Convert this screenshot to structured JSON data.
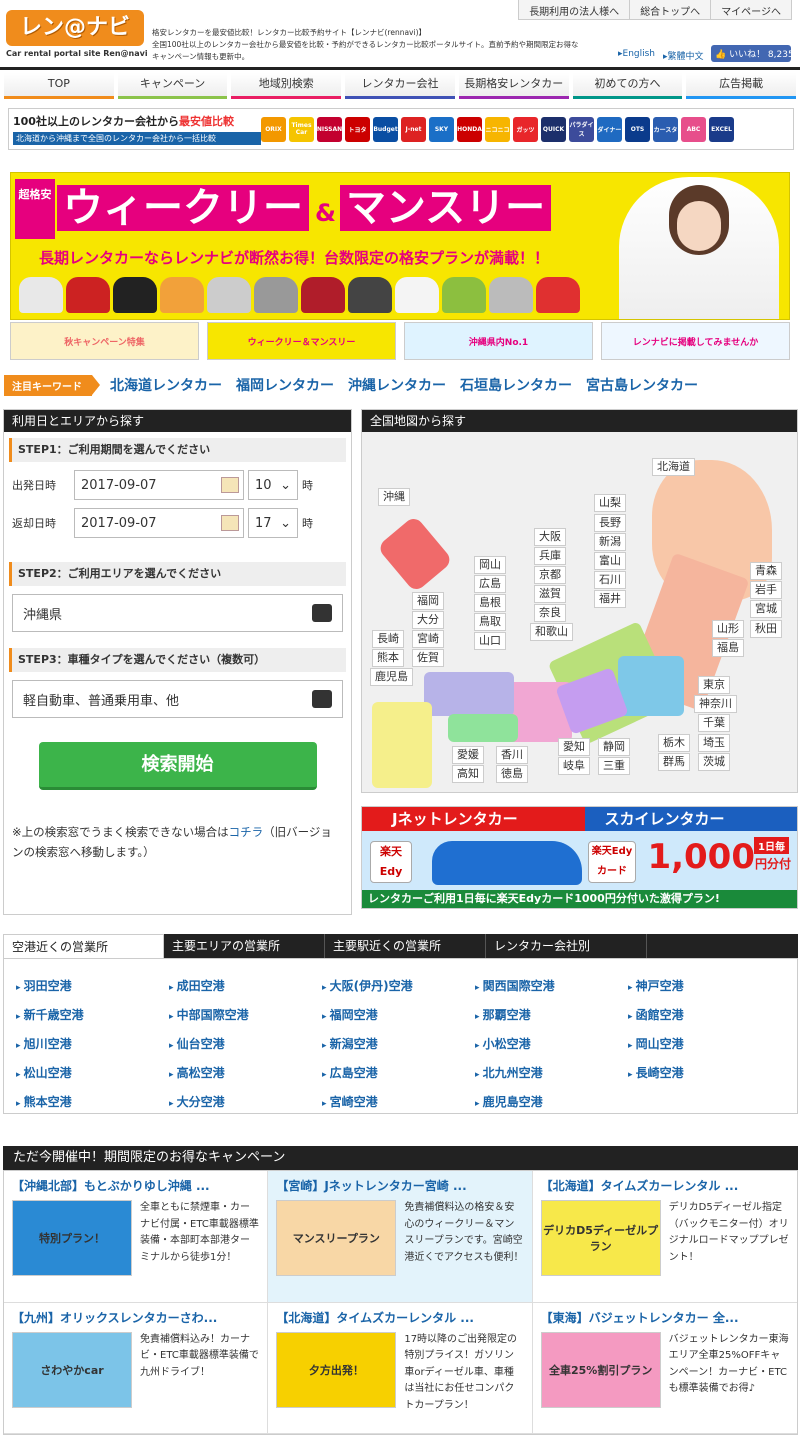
{
  "header": {
    "logo_text": "レン@ナビ",
    "logo_sub": "Car rental portal site Ren@navi",
    "intro_lines": [
      "格安レンタカーを最安値比較！レンタカー比較予約サイト【レンナビ(rennavi)】",
      "全国100社以上のレンタカー会社から最安値を比較・予約ができるレンタカー比較ポータルサイト。直前予約や期間限定お得な",
      "キャンペーン情報も更新中。"
    ],
    "top_links": [
      "長期利用の法人様へ",
      "総合トップへ",
      "マイページへ"
    ],
    "lang": [
      "▸English",
      "▸繁體中文"
    ],
    "like": "👍 いいね！ 8,235"
  },
  "nav": [
    "TOP",
    "キャンペーン",
    "地域別検索",
    "レンタカー会社",
    "長期格安レンタカー",
    "初めての方へ",
    "広告掲載"
  ],
  "company_banner": {
    "line1_a": "100社以上のレンタカー会社から",
    "line1_b": "最安値比較",
    "line2": "北海道から沖縄まで全国のレンタカー会社から一括比較",
    "logos": [
      {
        "name": "ORIX",
        "color": "#f39800"
      },
      {
        "name": "Times Car",
        "color": "#f5c400"
      },
      {
        "name": "NISSAN",
        "color": "#c3002f"
      },
      {
        "name": "トヨタ",
        "color": "#c00"
      },
      {
        "name": "Budget",
        "color": "#0a4ea3"
      },
      {
        "name": "J-net",
        "color": "#d22"
      },
      {
        "name": "SKY",
        "color": "#1a6fc7"
      },
      {
        "name": "HONDA",
        "color": "#cc0000"
      },
      {
        "name": "ニコニコ",
        "color": "#f7b500"
      },
      {
        "name": "ガッツ",
        "color": "#e8262a"
      },
      {
        "name": "QUICK",
        "color": "#1c2f6b"
      },
      {
        "name": "パラダイス",
        "color": "#3c4b9b"
      },
      {
        "name": "ダイナー",
        "color": "#1f6ac1"
      },
      {
        "name": "OTS",
        "color": "#0b3b8c"
      },
      {
        "name": "カースタ",
        "color": "#2a5db0"
      },
      {
        "name": "ABC",
        "color": "#e74e8b"
      },
      {
        "name": "EXCEL",
        "color": "#1a3b8a"
      }
    ]
  },
  "hero": {
    "cho": "超格安",
    "weekly": "ウィークリー",
    "amp": "&",
    "monthly": "マンスリー",
    "sub": "長期レンタカーならレンナビが断然お得！台数限定の格安プランが満載！！"
  },
  "sub_banners": [
    "秋キャンペーン特集",
    "ウィークリー＆マンスリー",
    "沖縄県内No.1",
    "レンナビに掲載してみませんか"
  ],
  "keywords": {
    "label": "注目キーワード",
    "items": [
      "北海道レンタカー",
      "福岡レンタカー",
      "沖縄レンタカー",
      "石垣島レンタカー",
      "宮古島レンタカー"
    ]
  },
  "search": {
    "title": "利用日とエリアから探す",
    "step1": "STEP1：ご利用期間を選んでください",
    "depart_label": "出発日時",
    "depart_date": "2017-09-07",
    "depart_hour": "10",
    "return_label": "返却日時",
    "return_date": "2017-09-07",
    "return_hour": "17",
    "hour_unit": "時",
    "step2": "STEP2：ご利用エリアを選んでください",
    "area": "沖縄県",
    "step3": "STEP3：車種タイプを選んでください（複数可）",
    "car_type": "軽自動車、普通乗用車、他",
    "button": "検索開始",
    "note_a": "※上の検索窓でうまく検索できない場合は",
    "note_link": "コチラ",
    "note_b": "（旧バージョンの検索窓へ移動します。）"
  },
  "map": {
    "title": "全国地図から探す",
    "prefs": [
      "北海道",
      "沖縄",
      "山梨",
      "長野",
      "新潟",
      "富山",
      "石川",
      "福井",
      "大阪",
      "兵庫",
      "京都",
      "滋賀",
      "奈良",
      "和歌山",
      "岡山",
      "広島",
      "島根",
      "鳥取",
      "山口",
      "福岡",
      "大分",
      "長崎",
      "宮崎",
      "熊本",
      "佐賀",
      "鹿児島",
      "青森",
      "岩手",
      "宮城",
      "山形",
      "秋田",
      "福島",
      "東京",
      "神奈川",
      "千葉",
      "栃木",
      "埼玉",
      "群馬",
      "茨城",
      "愛知",
      "静岡",
      "岐阜",
      "三重",
      "愛媛",
      "香川",
      "高知",
      "徳島"
    ]
  },
  "rakuten_banner": {
    "left": "Jネットレンタカー",
    "right": "スカイレンタカー",
    "edy1": "楽天Edy",
    "edy2": "楽天Edyカード",
    "big": "1,000",
    "big_unit": "円分付",
    "day": "1日毎",
    "bottom": "レンタカーご利用1日毎に楽天Edyカード1000円分付いた激得プラン!"
  },
  "tabs": [
    "空港近くの営業所",
    "主要エリアの営業所",
    "主要駅近くの営業所",
    "レンタカー会社別"
  ],
  "airports": [
    "羽田空港",
    "成田空港",
    "大阪(伊丹)空港",
    "関西国際空港",
    "神戸空港",
    "新千歳空港",
    "中部国際空港",
    "福岡空港",
    "那覇空港",
    "函館空港",
    "旭川空港",
    "仙台空港",
    "新潟空港",
    "小松空港",
    "岡山空港",
    "松山空港",
    "高松空港",
    "広島空港",
    "北九州空港",
    "長崎空港",
    "熊本空港",
    "大分空港",
    "宮崎空港",
    "鹿児島空港"
  ],
  "campaign": {
    "title": "ただ今開催中！期間限定のお得なキャンペーン",
    "items": [
      {
        "title": "【沖縄北部】もとぶかりゆし沖縄 ...",
        "img": "特別プラン！",
        "img_bg": "#2a8ad4",
        "desc": "全車ともに禁煙車・カーナビ付属・ETC車載器標準装備・本部町本部港ターミナルから徒歩1分！"
      },
      {
        "title": "【宮崎】Jネットレンタカー宮崎 ...",
        "img": "マンスリープラン",
        "img_bg": "#f8d7a6",
        "desc": "免責補償料込の格安＆安心のウィークリー＆マンスリープランです。宮崎空港近くでアクセスも便利！"
      },
      {
        "title": "【北海道】タイムズカーレンタル ...",
        "img": "デリカD5ディーゼルプラン",
        "img_bg": "#f7e84a",
        "desc": "デリカD5ディーゼル指定（バックモニター付）オリジナルロードマッププレゼント！"
      },
      {
        "title": "【九州】オリックスレンタカーさわ...",
        "img": "さわやかcar",
        "img_bg": "#7cc4e8",
        "desc": "免責補償料込み！カーナビ・ETC車載器標準装備で九州ドライブ！"
      },
      {
        "title": "【北海道】タイムズカーレンタル ...",
        "img": "夕方出発！",
        "img_bg": "#f7d000",
        "desc": "17時以降のご出発限定の特別プライス！ガソリン車orディーゼル車、車種は当社にお任せコンパクトカープラン！"
      },
      {
        "title": "【東海】バジェットレンタカー 全...",
        "img": "全車25%割引プラン",
        "img_bg": "#f49ac1",
        "desc": "バジェットレンタカー東海エリア全車25%OFFキャンペーン！カーナビ・ETCも標準装備でお得♪"
      }
    ]
  }
}
